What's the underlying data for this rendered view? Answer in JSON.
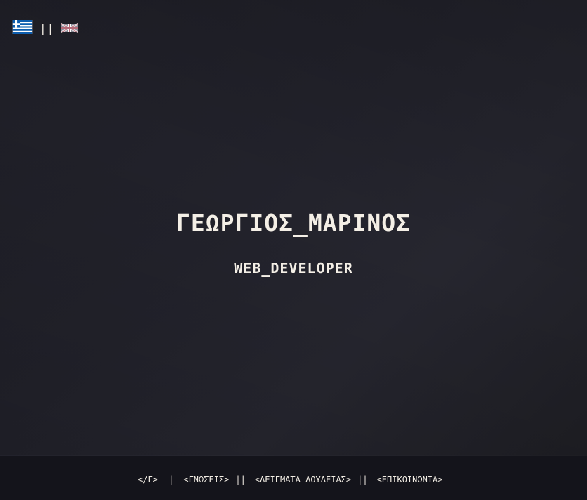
{
  "language_switcher": {
    "separator": "||",
    "languages": [
      {
        "code": "el",
        "icon": "greek-flag-icon",
        "active": true
      },
      {
        "code": "en",
        "icon": "uk-flag-icon",
        "active": false
      }
    ]
  },
  "hero": {
    "name": "ΓΕΩΡΓΙΟΣ_ΜΑΡΙΝΟΣ",
    "title": "WEB_DEVELOPER"
  },
  "nav": {
    "logo": "</Γ>",
    "separator": "||",
    "items": [
      {
        "label": "<ΓΝΩΣΕΙΣ>"
      },
      {
        "label": "<ΔΕΙΓΜΑΤΑ ΔΟΥΛΕΙΑΣ>"
      },
      {
        "label": "<ΕΠΙΚΟΙΝΩΝΙΑ>"
      }
    ]
  },
  "colors": {
    "background": "#1f1f27",
    "footer": "#14141b",
    "text": "#f4efe6",
    "greek_flag_blue": "#0d5eaf"
  }
}
